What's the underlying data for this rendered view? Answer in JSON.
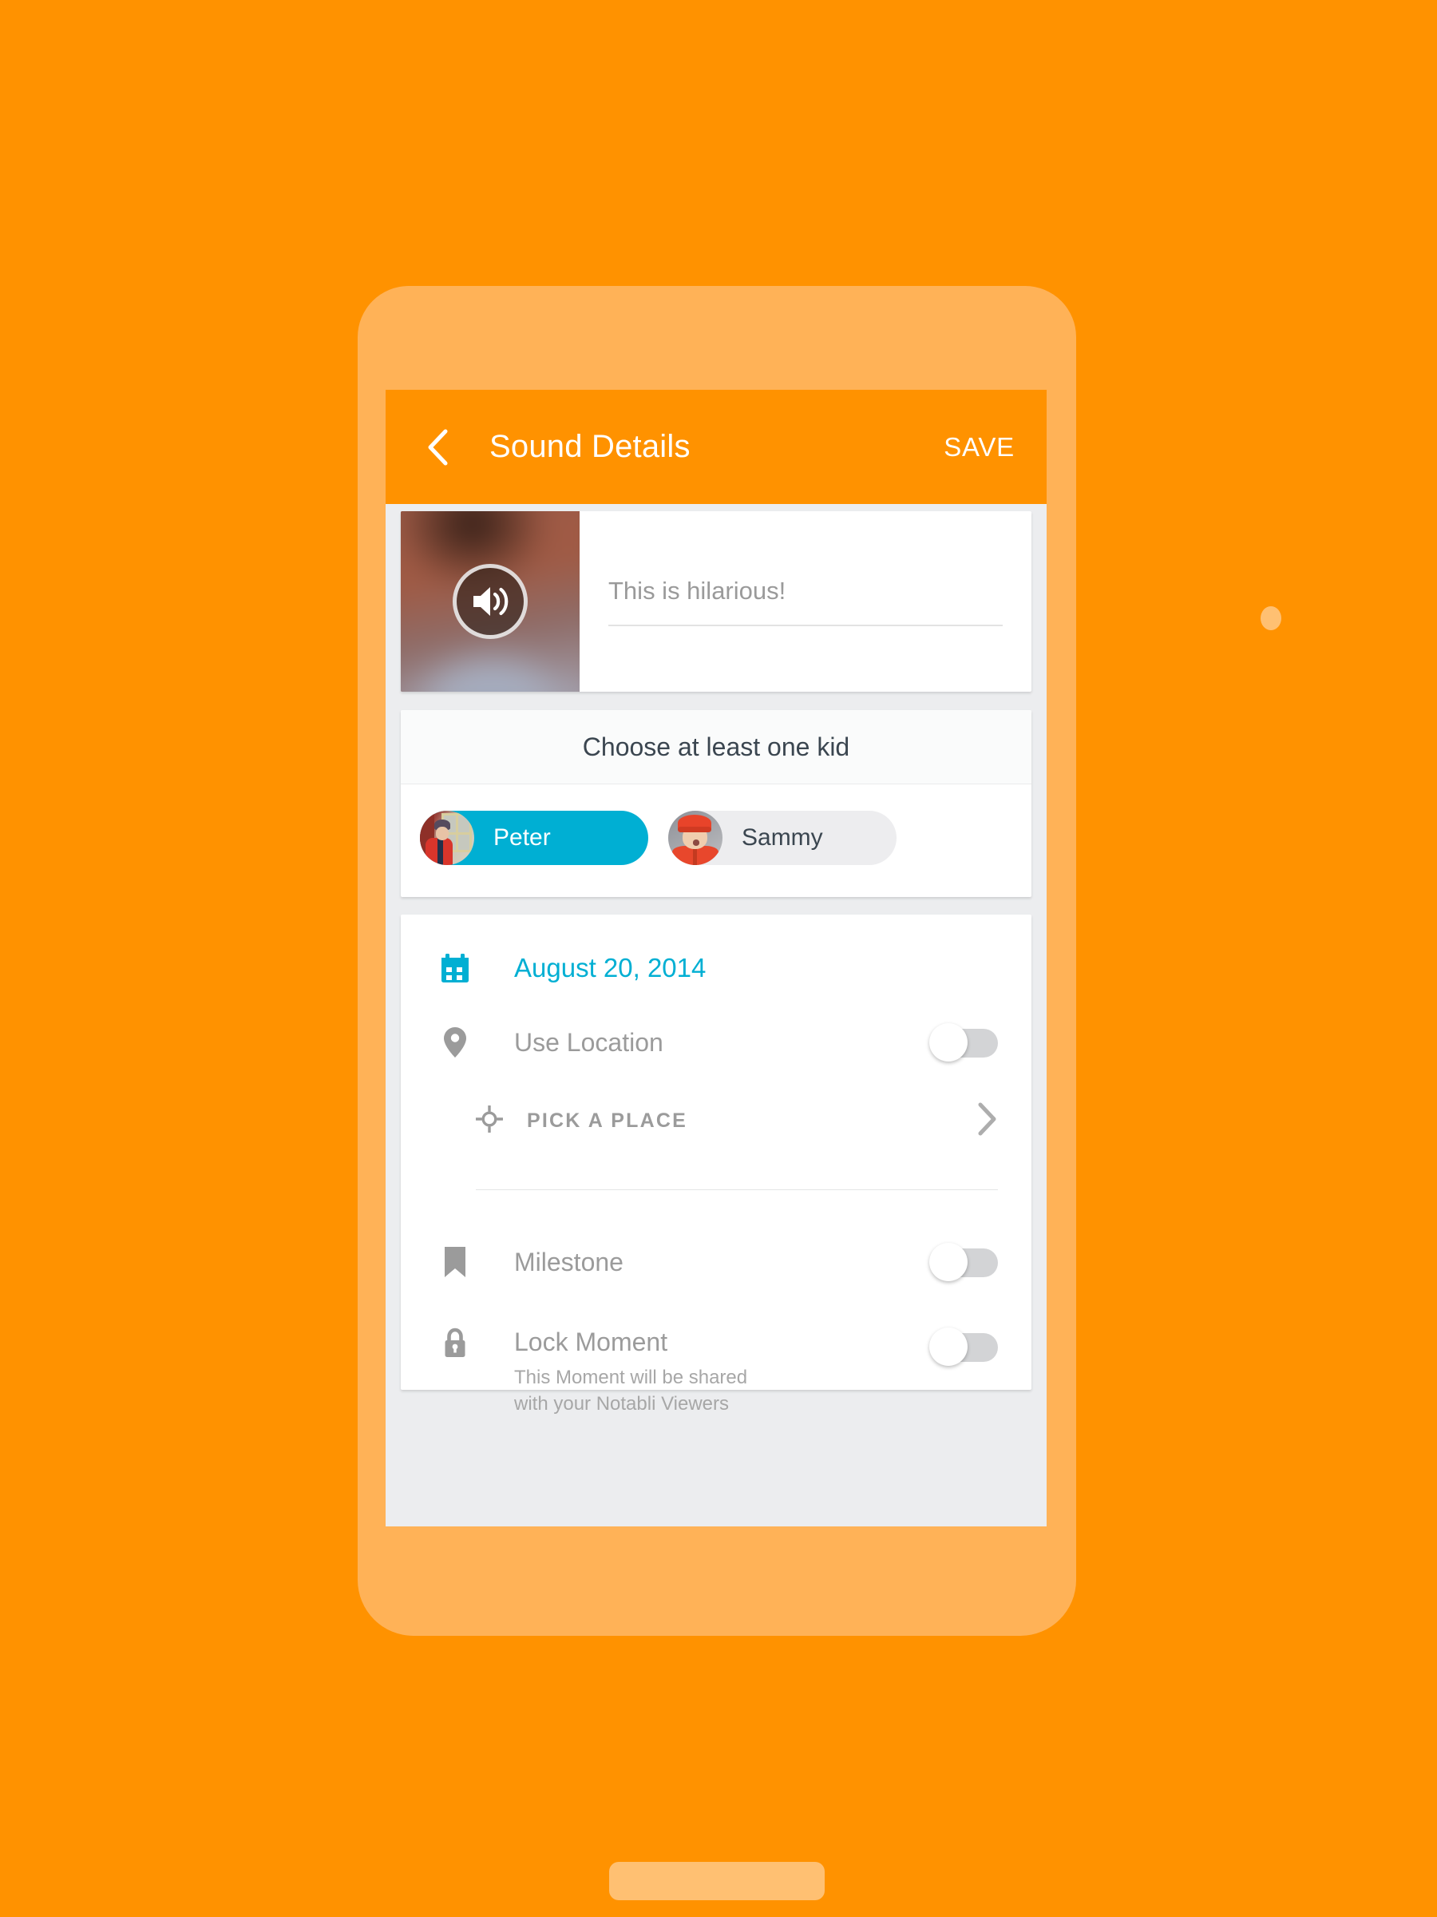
{
  "colors": {
    "background": "#FF9200",
    "phone_bezel": "#FFB257",
    "app_bar": "#FF9200",
    "accent_cyan": "#00AFD3",
    "screen_bg": "#ECEDEF",
    "card": "#FFFFFF",
    "muted_text": "#9B9B9B",
    "dark_text": "#3B4650"
  },
  "app_bar": {
    "back_icon": "chevron-left-icon",
    "title": "Sound Details",
    "save_label": "SAVE"
  },
  "media": {
    "thumbnail_icon": "speaker-volume-icon",
    "caption_value": "",
    "caption_placeholder": "This is hilarious!"
  },
  "kids": {
    "header": "Choose at least one kid",
    "items": [
      {
        "name": "Peter",
        "selected": true,
        "avatar": "peter-avatar"
      },
      {
        "name": "Sammy",
        "selected": false,
        "avatar": "sammy-avatar"
      }
    ]
  },
  "options": {
    "date": {
      "icon": "calendar-icon",
      "value": "August 20, 2014"
    },
    "location": {
      "icon": "map-pin-icon",
      "label": "Use Location",
      "toggle_on": false
    },
    "pick_place": {
      "icon": "crosshair-icon",
      "label": "PICK A PLACE",
      "chevron_icon": "chevron-right-icon"
    },
    "milestone": {
      "icon": "bookmark-icon",
      "label": "Milestone",
      "toggle_on": false
    },
    "lock_moment": {
      "icon": "lock-icon",
      "label": "Lock Moment",
      "description": "This Moment will be shared with your Notabli Viewers",
      "toggle_on": false
    }
  }
}
